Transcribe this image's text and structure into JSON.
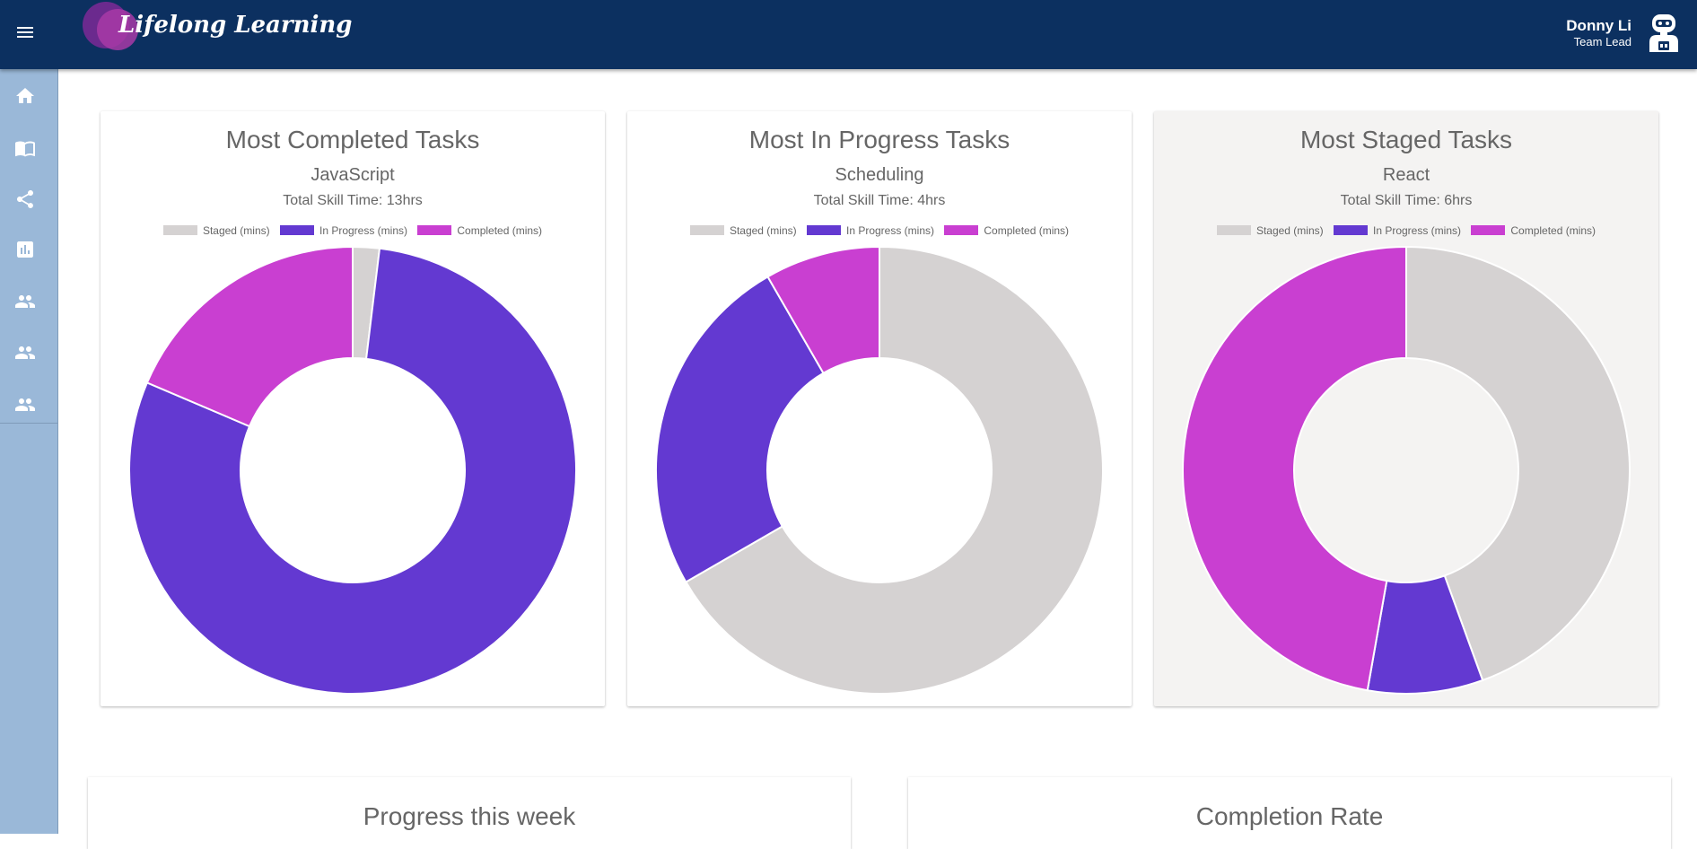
{
  "header": {
    "app_name": "Lifelong Learning",
    "user_name": "Donny Li",
    "user_role": "Team Lead",
    "icons": [
      "menu-icon",
      "robot-avatar-icon"
    ],
    "background_color": "#0c3060"
  },
  "sidebar": {
    "background_color": "#9ab8d8",
    "items": [
      {
        "icon": "home-icon"
      },
      {
        "icon": "book-icon"
      },
      {
        "icon": "share-icon"
      },
      {
        "icon": "chart-icon"
      },
      {
        "icon": "people-icon"
      },
      {
        "icon": "people-icon"
      },
      {
        "icon": "people-icon"
      }
    ]
  },
  "legend_labels": {
    "staged": "Staged (mins)",
    "in_progress": "In Progress (mins)",
    "completed": "Completed (mins)"
  },
  "colors": {
    "staged": "#d5d2d2",
    "in_progress": "#6339d1",
    "completed": "#c93fd1"
  },
  "cards": [
    {
      "title": "Most Completed Tasks",
      "skill": "JavaScript",
      "total": "Total Skill Time: 13hrs",
      "highlighted": false
    },
    {
      "title": "Most In Progress Tasks",
      "skill": "Scheduling",
      "total": "Total Skill Time: 4hrs",
      "highlighted": false
    },
    {
      "title": "Most Staged Tasks",
      "skill": "React",
      "total": "Total Skill Time: 6hrs",
      "highlighted": true
    }
  ],
  "chart_data": [
    {
      "type": "pie",
      "title": "Most Completed Tasks",
      "categories": [
        "Staged (mins)",
        "In Progress (mins)",
        "Completed (mins)"
      ],
      "values": [
        15,
        620,
        145
      ]
    },
    {
      "type": "pie",
      "title": "Most In Progress Tasks",
      "categories": [
        "Staged (mins)",
        "In Progress (mins)",
        "Completed (mins)"
      ],
      "values": [
        160,
        60,
        20
      ]
    },
    {
      "type": "pie",
      "title": "Most Staged Tasks",
      "categories": [
        "Staged (mins)",
        "In Progress (mins)",
        "Completed (mins)"
      ],
      "values": [
        160,
        30,
        170
      ]
    }
  ],
  "bottom_cards": [
    {
      "title": "Progress this week"
    },
    {
      "title": "Completion Rate"
    }
  ]
}
